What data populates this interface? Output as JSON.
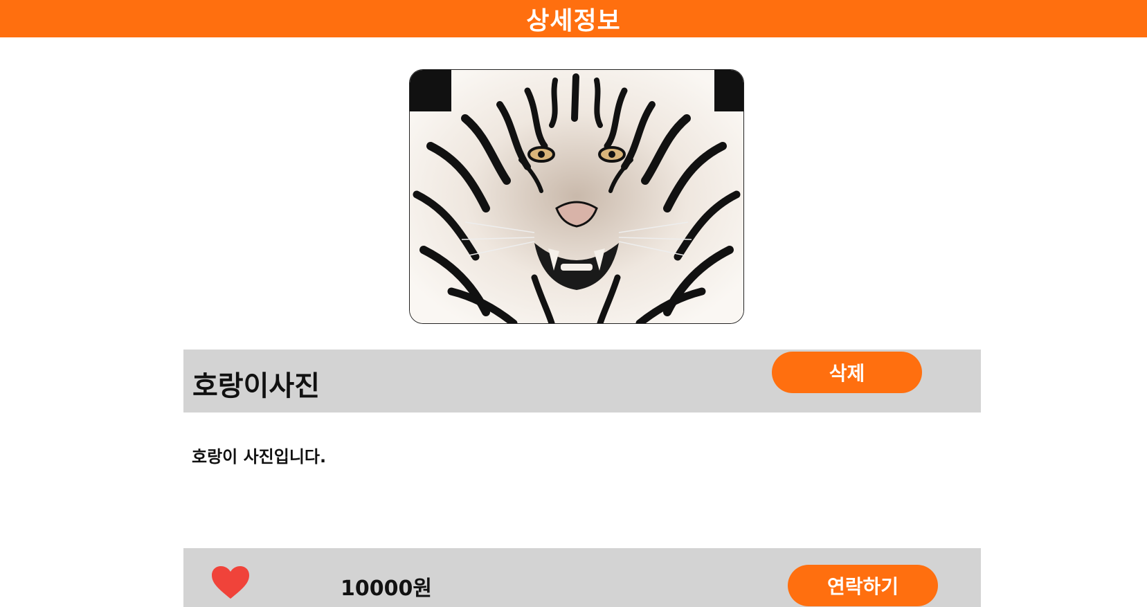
{
  "header": {
    "title": "상세정보"
  },
  "product": {
    "title": "호랑이사진",
    "description": "호랑이 사진입니다.",
    "price": "10000원",
    "image_icon": "tiger-photo"
  },
  "actions": {
    "delete_label": "삭제",
    "contact_label": "연락하기",
    "like_icon": "heart-icon"
  },
  "colors": {
    "accent": "#ff6f0f",
    "bar_bg": "#d3d3d3",
    "heart": "#f0433a",
    "text": "#111111"
  }
}
